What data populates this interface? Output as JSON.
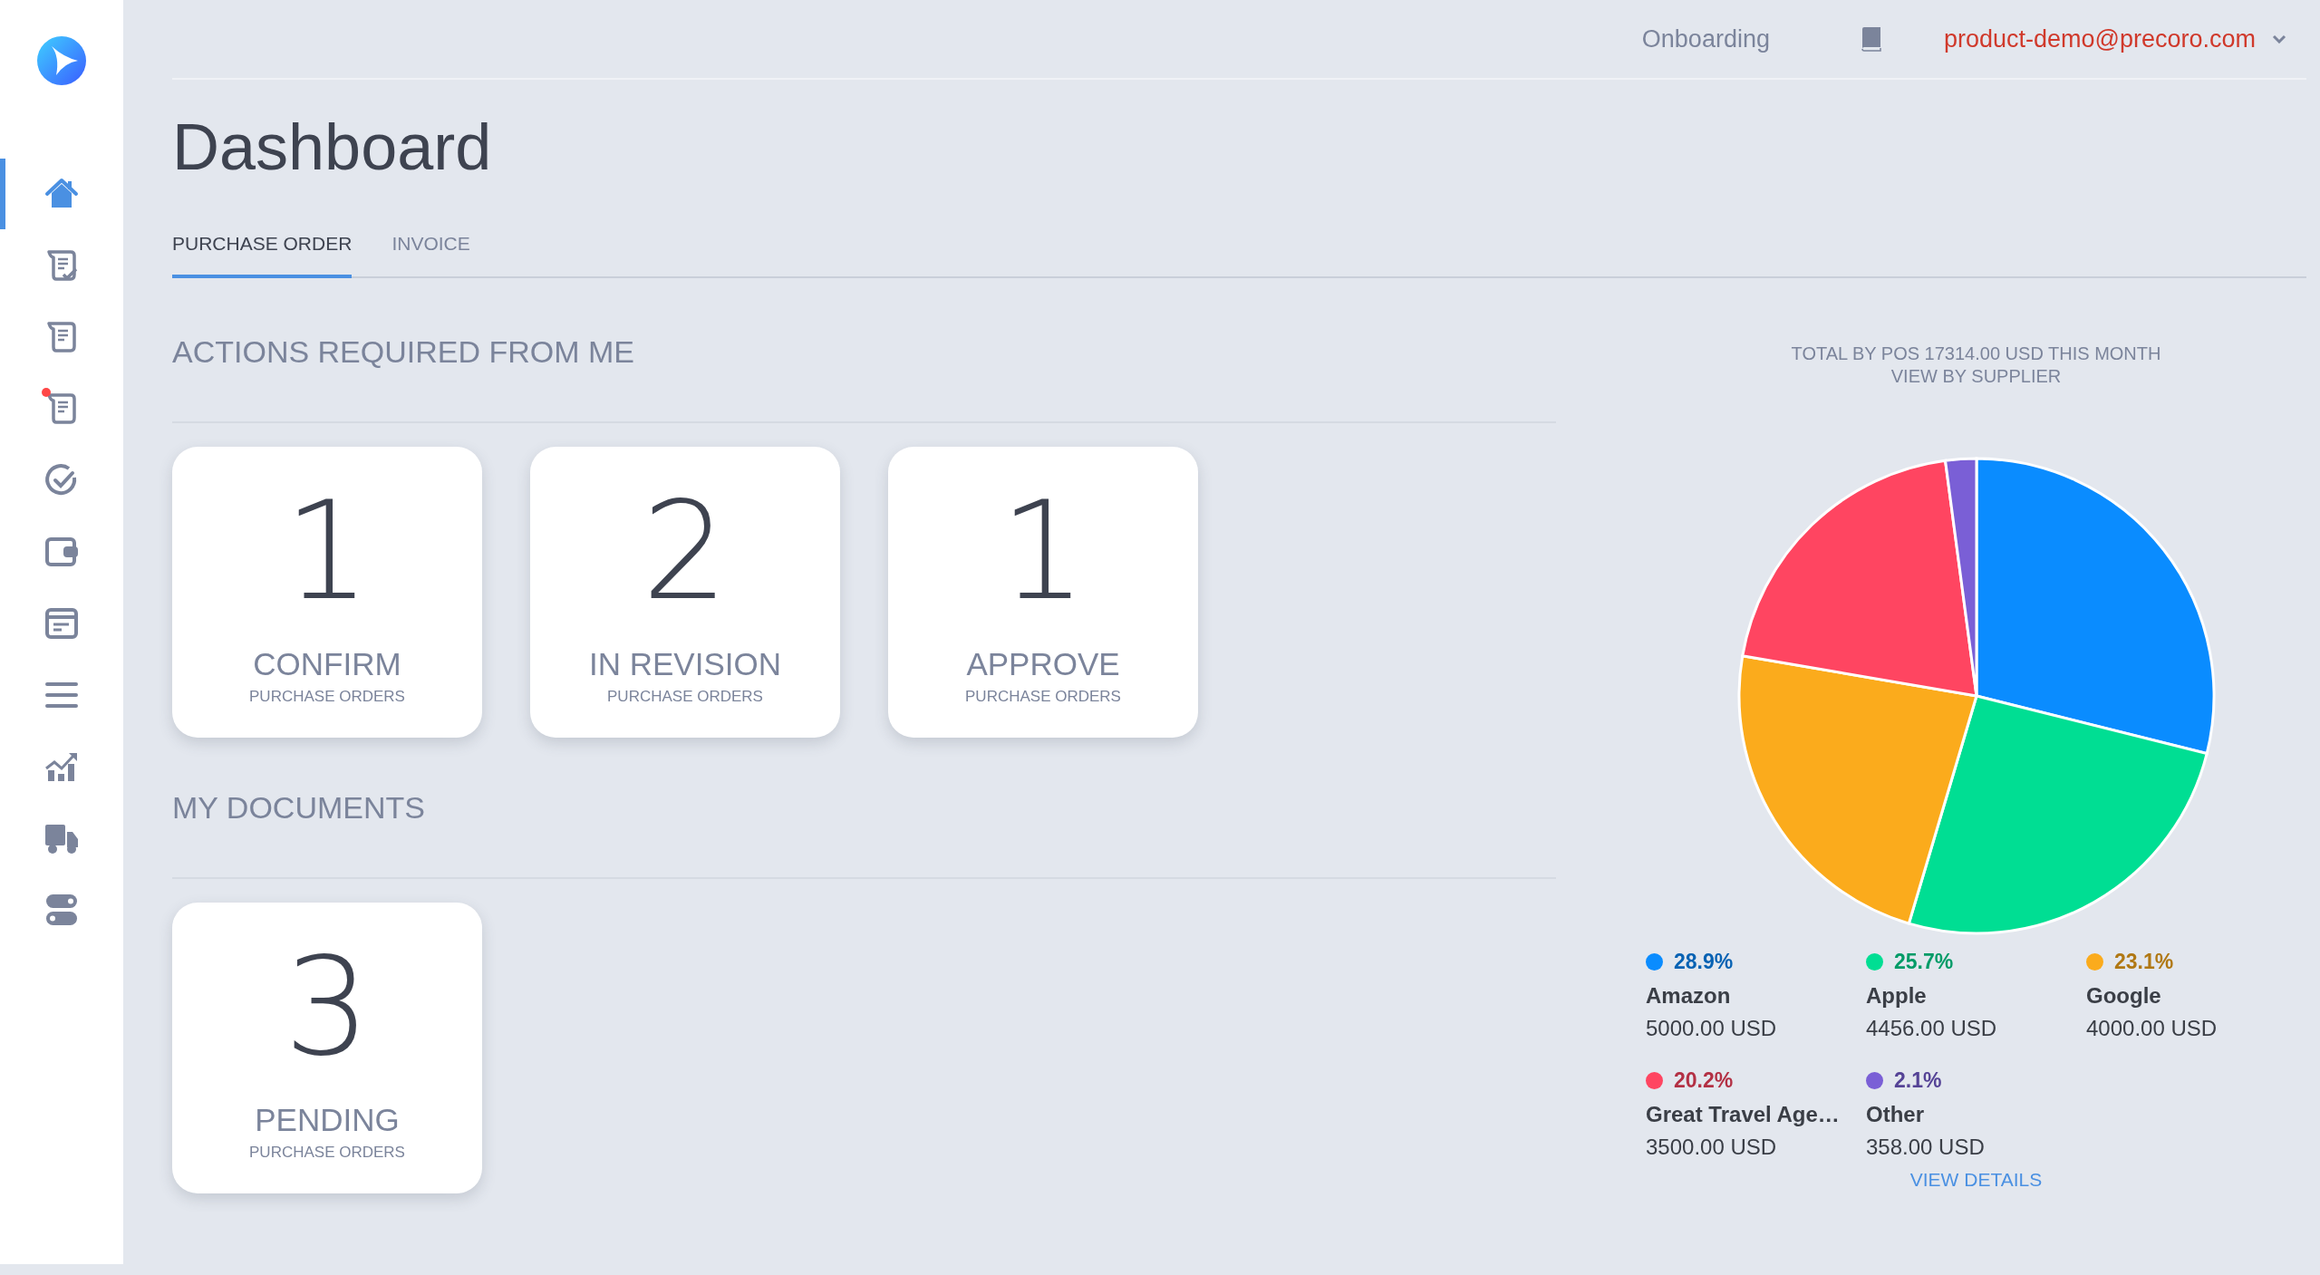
{
  "sidebar": {
    "items": [
      {
        "selected": true,
        "notification": false
      },
      {
        "selected": false,
        "notification": false
      },
      {
        "selected": false,
        "notification": false
      },
      {
        "selected": false,
        "notification": true
      },
      {
        "selected": false,
        "notification": false
      },
      {
        "selected": false,
        "notification": false
      },
      {
        "selected": false,
        "notification": false
      },
      {
        "selected": false,
        "notification": false
      },
      {
        "selected": false,
        "notification": false
      },
      {
        "selected": false,
        "notification": false
      },
      {
        "selected": false,
        "notification": false
      }
    ]
  },
  "top_bar": {
    "onboarding": "Onboarding",
    "user_email": "product-demo@precoro.com"
  },
  "page_title": "Dashboard",
  "tabs": [
    {
      "label": "PURCHASE ORDER",
      "selected": true
    },
    {
      "label": "INVOICE",
      "selected": false
    }
  ],
  "sections": [
    {
      "title": "ACTIONS REQUIRED FROM ME",
      "cards": [
        {
          "count": "1",
          "label": "CONFIRM",
          "sublabel": "PURCHASE ORDERS"
        },
        {
          "count": "2",
          "label": "IN REVISION",
          "sublabel": "PURCHASE ORDERS"
        },
        {
          "count": "1",
          "label": "APPROVE",
          "sublabel": "PURCHASE ORDERS"
        }
      ]
    },
    {
      "title": "MY DOCUMENTS",
      "cards": [
        {
          "count": "3",
          "label": "PENDING",
          "sublabel": "PURCHASE ORDERS"
        }
      ]
    }
  ],
  "summary": {
    "title": "TOTAL BY POS 17314.00 USD THIS MONTH",
    "subtitle": "VIEW BY SUPPLIER",
    "chart_data": {
      "type": "pie",
      "categories": [
        "Amazon",
        "Apple",
        "Google",
        "Great Travel Age…",
        "Other"
      ],
      "values": [
        28.9,
        25.7,
        23.1,
        20.2,
        2.1
      ]
    },
    "legend": [
      {
        "percent": "28.9%",
        "amount": "5000.00 USD",
        "color": "#0a8cff"
      },
      {
        "percent": "25.7%",
        "amount": "4456.00 USD",
        "color": "#00de93"
      },
      {
        "percent": "23.1%",
        "amount": "4000.00 USD",
        "color": "#fbab1c"
      },
      {
        "percent": "20.2%",
        "amount": "3500.00 USD",
        "color": "#ff4561"
      },
      {
        "percent": "2.1%",
        "amount": "358.00 USD",
        "color": "#7a5fd6"
      }
    ],
    "link": "VIEW DETAILS"
  }
}
